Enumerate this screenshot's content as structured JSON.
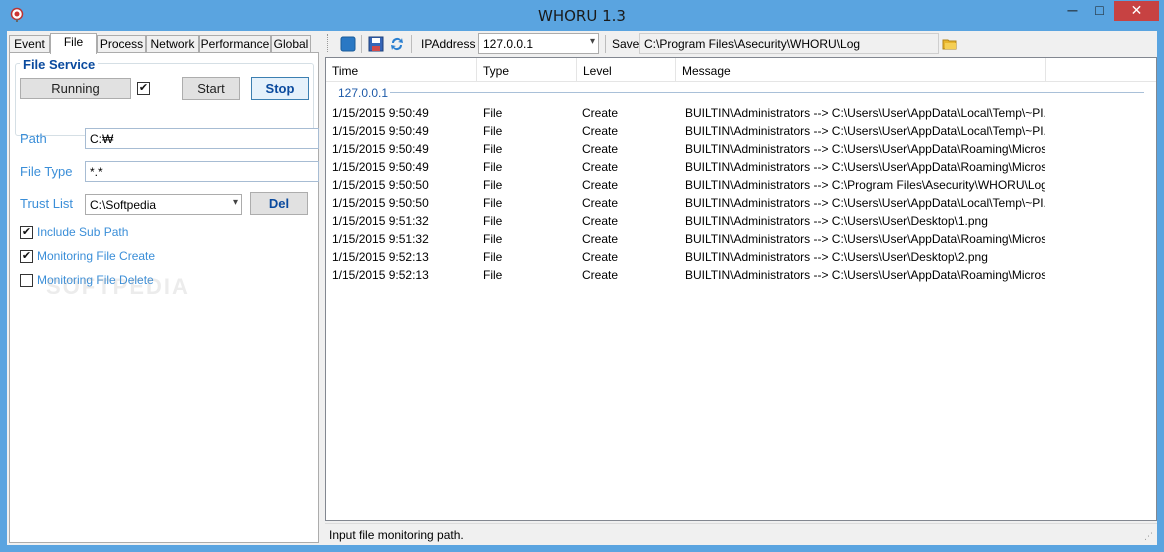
{
  "window": {
    "title": "WHORU 1.3",
    "minimize_glyph": "─",
    "maximize_glyph": "□",
    "close_glyph": "✕"
  },
  "left": {
    "tabs": [
      {
        "label": "Event",
        "active": false
      },
      {
        "label": "File",
        "active": true
      },
      {
        "label": "Process",
        "active": false
      },
      {
        "label": "Network",
        "active": false
      },
      {
        "label": "Performance",
        "active": false
      },
      {
        "label": "Global",
        "active": false
      }
    ],
    "file_service": {
      "group_title": "File Service",
      "status_label": "Running",
      "status_checked": true,
      "start_label": "Start",
      "stop_label": "Stop"
    },
    "path": {
      "label": "Path",
      "value": "C:₩"
    },
    "file_type": {
      "label": "File Type",
      "value": "*.*"
    },
    "trust_list": {
      "label": "Trust List",
      "value": "C:\\Softpedia",
      "del_label": "Del"
    },
    "options": [
      {
        "label": "Include Sub Path",
        "checked": true
      },
      {
        "label": "Monitoring File Create",
        "checked": true
      },
      {
        "label": "Monitoring File Delete",
        "checked": false
      }
    ],
    "watermark": "SOFTPEDIA"
  },
  "toolbar": {
    "ip_label": "IPAddress",
    "ip_value": "127.0.0.1",
    "save_label": "Save",
    "save_path": "C:\\Program Files\\Asecurity\\WHORU\\Log"
  },
  "log": {
    "columns": [
      "Time",
      "Type",
      "Level",
      "Message"
    ],
    "group": "127.0.0.1",
    "rows": [
      {
        "time": "1/15/2015 9:50:49",
        "type": "File",
        "level": "Create",
        "message": "BUILTIN\\Administrators --> C:\\Users\\User\\AppData\\Local\\Temp\\~PI..."
      },
      {
        "time": "1/15/2015 9:50:49",
        "type": "File",
        "level": "Create",
        "message": "BUILTIN\\Administrators --> C:\\Users\\User\\AppData\\Local\\Temp\\~PI..."
      },
      {
        "time": "1/15/2015 9:50:49",
        "type": "File",
        "level": "Create",
        "message": "BUILTIN\\Administrators --> C:\\Users\\User\\AppData\\Roaming\\Microso..."
      },
      {
        "time": "1/15/2015 9:50:49",
        "type": "File",
        "level": "Create",
        "message": "BUILTIN\\Administrators --> C:\\Users\\User\\AppData\\Roaming\\Microso..."
      },
      {
        "time": "1/15/2015 9:50:50",
        "type": "File",
        "level": "Create",
        "message": "BUILTIN\\Administrators --> C:\\Program Files\\Asecurity\\WHORU\\Log\\W..."
      },
      {
        "time": "1/15/2015 9:50:50",
        "type": "File",
        "level": "Create",
        "message": "BUILTIN\\Administrators --> C:\\Users\\User\\AppData\\Local\\Temp\\~PI..."
      },
      {
        "time": "1/15/2015 9:51:32",
        "type": "File",
        "level": "Create",
        "message": "BUILTIN\\Administrators --> C:\\Users\\User\\Desktop\\1.png"
      },
      {
        "time": "1/15/2015 9:51:32",
        "type": "File",
        "level": "Create",
        "message": "BUILTIN\\Administrators --> C:\\Users\\User\\AppData\\Roaming\\Microso..."
      },
      {
        "time": "1/15/2015 9:52:13",
        "type": "File",
        "level": "Create",
        "message": "BUILTIN\\Administrators --> C:\\Users\\User\\Desktop\\2.png"
      },
      {
        "time": "1/15/2015 9:52:13",
        "type": "File",
        "level": "Create",
        "message": "BUILTIN\\Administrators --> C:\\Users\\User\\AppData\\Roaming\\Microso..."
      }
    ]
  },
  "status": {
    "text": "Input file monitoring path."
  },
  "colors": {
    "accent": "#5aa4e0",
    "label_blue": "#3a8ed8",
    "group_title": "#0a4a9e",
    "close_red": "#c74242"
  }
}
